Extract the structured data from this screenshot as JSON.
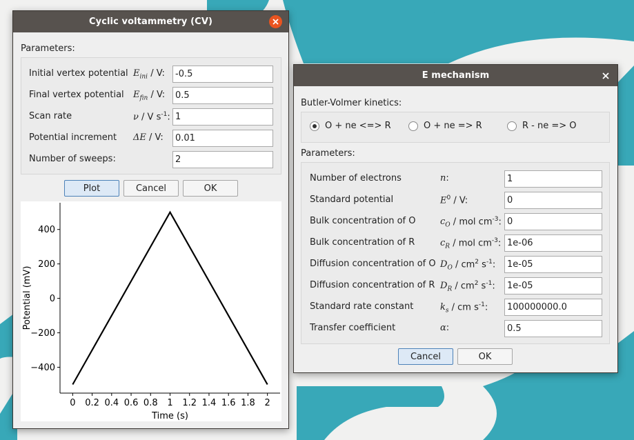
{
  "cv_window": {
    "title": "Cyclic voltammetry (CV)",
    "parameters_label": "Parameters:",
    "initial_vertex": {
      "label": "Initial vertex potential",
      "value": "-0.5"
    },
    "final_vertex": {
      "label": "Final vertex potential",
      "value": "0.5"
    },
    "scan_rate": {
      "label": "Scan rate",
      "value": "1"
    },
    "potential_increment": {
      "label": "Potential increment",
      "value": "0.01"
    },
    "number_of_sweeps": {
      "label": "Number of sweeps:",
      "value": "2"
    },
    "buttons": {
      "plot": "Plot",
      "cancel": "Cancel",
      "ok": "OK"
    }
  },
  "chart_data": {
    "type": "line",
    "title": "",
    "xlabel": "Time (s)",
    "ylabel": "Potential (mV)",
    "xlim": [
      -0.13,
      2.13
    ],
    "ylim": [
      -550,
      555
    ],
    "xticks": [
      0,
      0.2,
      0.4,
      0.6,
      0.8,
      1,
      1.2,
      1.4,
      1.6,
      1.8,
      2
    ],
    "xtick_labels": [
      "0",
      "0.2",
      "0.4",
      "0.6",
      "0.8",
      "1",
      "1.2",
      "1.4",
      "1.6",
      "1.8",
      "2"
    ],
    "yticks": [
      -400,
      -200,
      0,
      200,
      400
    ],
    "ytick_labels": [
      "−400",
      "−200",
      "0",
      "200",
      "400"
    ],
    "grid": false,
    "series": [
      {
        "x": [
          0,
          1,
          2
        ],
        "y": [
          -500,
          500,
          -500
        ],
        "color": "#000000"
      }
    ]
  },
  "e_window": {
    "title": "E mechanism",
    "kinetics_label": "Butler-Volmer kinetics:",
    "radio_options": [
      {
        "label": "O + ne <=> R",
        "selected": true
      },
      {
        "label": "O + ne => R",
        "selected": false
      },
      {
        "label": "R - ne => O",
        "selected": false
      }
    ],
    "parameters_label": "Parameters:",
    "n_electrons": {
      "label": "Number of electrons",
      "value": "1"
    },
    "std_potential": {
      "label": "Standard potential",
      "value": "0"
    },
    "bulk_o": {
      "label": "Bulk concentration of O",
      "value": "0"
    },
    "bulk_r": {
      "label": "Bulk concentration of R",
      "value": "1e-06"
    },
    "diff_o": {
      "label": "Diffusion concentration of O",
      "value": "1e-05"
    },
    "diff_r": {
      "label": "Diffusion concentration of R",
      "value": "1e-05"
    },
    "rate_constant": {
      "label": "Standard rate constant",
      "value": "100000000.0"
    },
    "transfer_coeff": {
      "label": "Transfer coefficient",
      "value": "0.5"
    },
    "buttons": {
      "cancel": "Cancel",
      "ok": "OK"
    }
  },
  "colors": {
    "title_bar": "#57524e",
    "close_accent": "#e95420",
    "background_teal": "#38a8b8"
  }
}
